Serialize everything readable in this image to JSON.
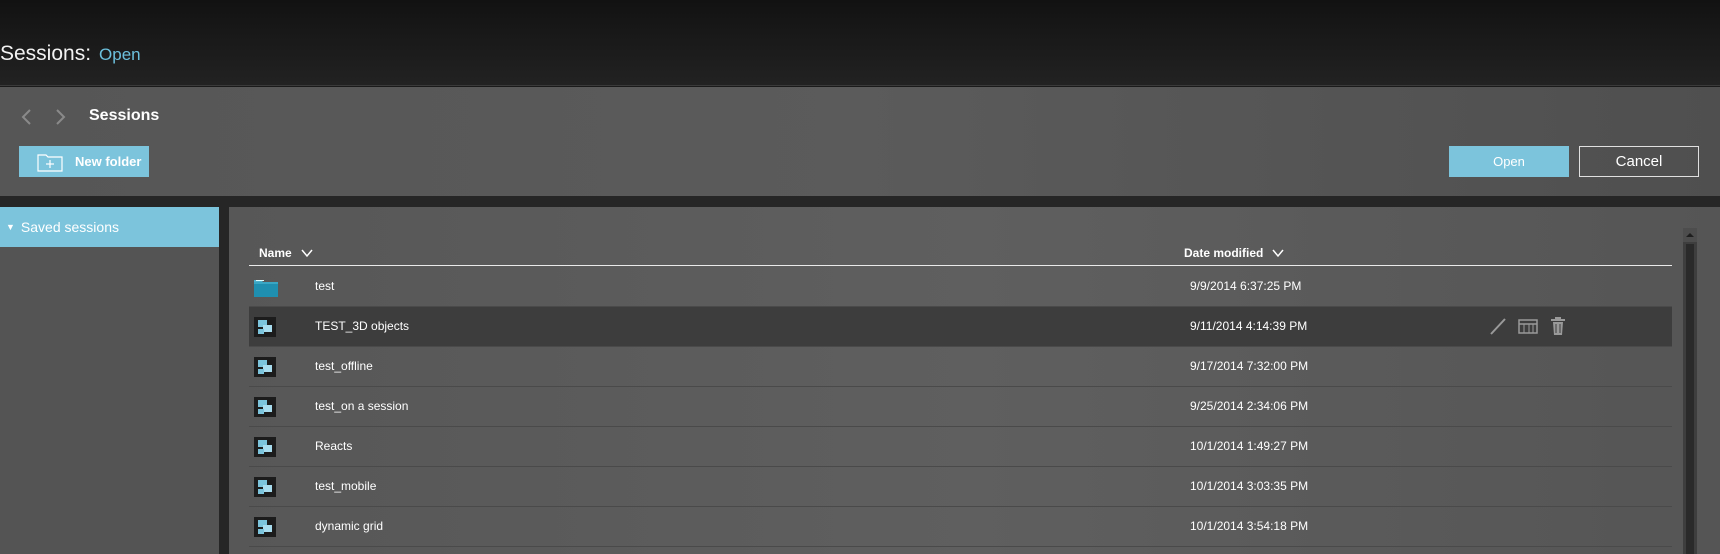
{
  "app": {
    "title": "Sessions:",
    "mode": "Open"
  },
  "dialog": {
    "title": "Sessions",
    "new_folder_label": "New folder",
    "open_label": "Open",
    "cancel_label": "Cancel"
  },
  "sidebar": {
    "items": [
      {
        "label": "Saved sessions",
        "expanded": true,
        "selected": true
      }
    ]
  },
  "table": {
    "columns": [
      {
        "label": "Name",
        "sort": "chevron-down-icon"
      },
      {
        "label": "Date modified",
        "sort": "chevron-down-icon"
      }
    ],
    "rows": [
      {
        "icon": "folder-icon",
        "name": "test",
        "date": "9/9/2014 6:37:25 PM",
        "selected": false
      },
      {
        "icon": "session-icon",
        "name": "TEST_3D objects",
        "date": "9/11/2014 4:14:39 PM",
        "selected": true
      },
      {
        "icon": "session-icon",
        "name": "test_offline",
        "date": "9/17/2014 7:32:00 PM",
        "selected": false
      },
      {
        "icon": "session-icon",
        "name": "test_on a session",
        "date": "9/25/2014 2:34:06 PM",
        "selected": false
      },
      {
        "icon": "session-icon",
        "name": "Reacts",
        "date": "10/1/2014 1:49:27 PM",
        "selected": false
      },
      {
        "icon": "session-icon",
        "name": "test_mobile",
        "date": "10/1/2014 3:03:35 PM",
        "selected": false
      },
      {
        "icon": "session-icon",
        "name": "dynamic grid",
        "date": "10/1/2014 3:54:18 PM",
        "selected": false
      }
    ],
    "row_actions": [
      "rename-icon",
      "properties-icon",
      "delete-icon"
    ]
  },
  "colors": {
    "accent": "#7cc4dc",
    "mode_text": "#6cc0dd",
    "panel": "#5a5a5a",
    "topbar": "#1a1a1a",
    "selected_row": "#3d3d3d"
  }
}
